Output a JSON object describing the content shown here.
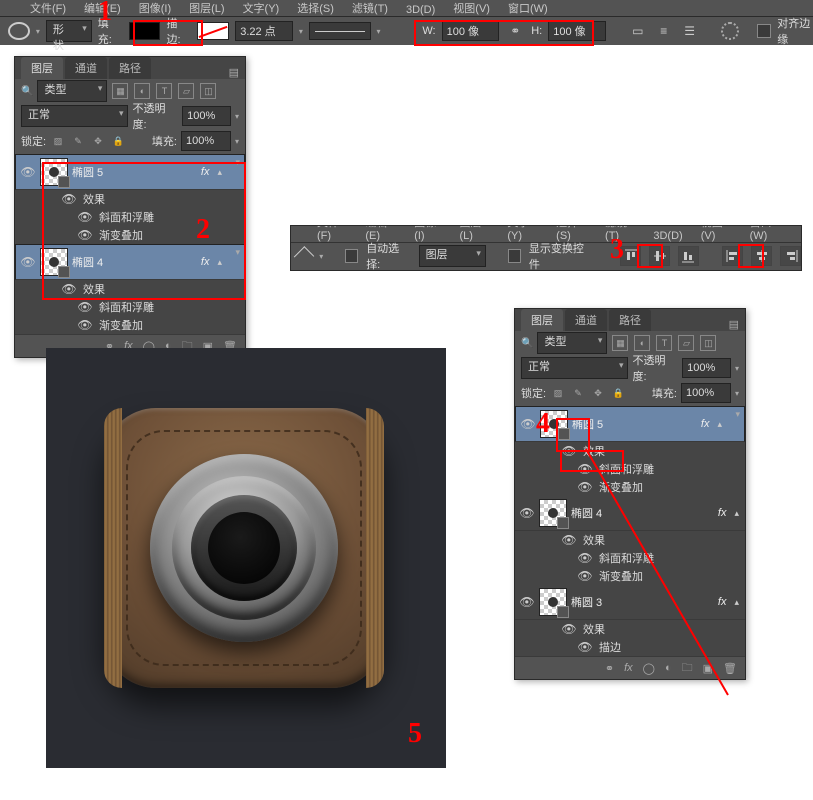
{
  "menu": [
    "文件(F)",
    "编辑(E)",
    "图像(I)",
    "图层(L)",
    "文字(Y)",
    "选择(S)",
    "滤镜(T)",
    "3D(D)",
    "视图(V)",
    "窗口(W)"
  ],
  "opt": {
    "shape": "形状",
    "fill_label": "填充:",
    "stroke_label": "描边:",
    "stroke_w": "3.22 点",
    "w_label": "W:",
    "w_val": "100 像",
    "h_label": "H:",
    "h_val": "100 像",
    "align_edges": "对齐边缘"
  },
  "move": {
    "autosel_label": "自动选择:",
    "autosel_target": "图层",
    "show_transform": "显示变换控件"
  },
  "panel": {
    "tabs": [
      "图层",
      "通道",
      "路径"
    ],
    "filter_label": "类型",
    "blend": "正常",
    "opacity_label": "不透明度:",
    "opacity_val": "100%",
    "lock_label": "锁定:",
    "fill_label": "填充:",
    "fill_val": "100%"
  },
  "layersA": [
    {
      "name": "椭圆 5",
      "selected": true,
      "fx": true,
      "effects": [
        "效果",
        "斜面和浮雕",
        "渐变叠加"
      ]
    },
    {
      "name": "椭圆 4",
      "selected": true,
      "fx": true,
      "effects": [
        "效果",
        "斜面和浮雕",
        "渐变叠加"
      ]
    }
  ],
  "layersB": [
    {
      "name": "椭圆 5",
      "selected": true,
      "fx": true,
      "effects": [
        "效果",
        "斜面和浮雕",
        "渐变叠加"
      ]
    },
    {
      "name": "椭圆 4",
      "selected": false,
      "fx": true,
      "effects": [
        "效果",
        "斜面和浮雕",
        "渐变叠加"
      ]
    },
    {
      "name": "椭圆 3",
      "selected": false,
      "fx": true,
      "effects": [
        "效果",
        "描边"
      ]
    }
  ],
  "annotations": {
    "1": "1",
    "2": "2",
    "3": "3",
    "4": "4",
    "5": "5"
  }
}
